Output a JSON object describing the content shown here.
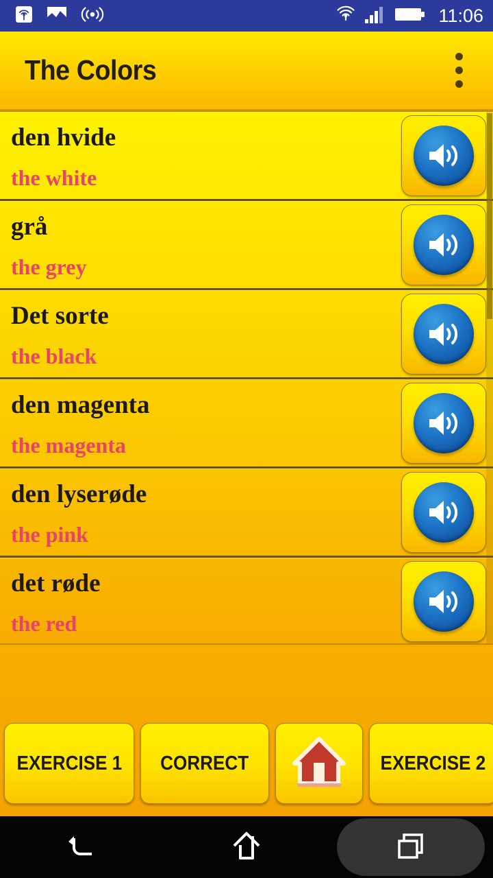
{
  "statusbar": {
    "time": "11:06",
    "left_icons": [
      {
        "name": "nfc-icon",
        "label": "nfc"
      },
      {
        "name": "screenshot-image-icon",
        "label": "screenshot"
      },
      {
        "name": "wifi-hotspot-icon",
        "label": "hotspot"
      }
    ],
    "right_icons": [
      {
        "name": "wifi-icon",
        "label": "wifi"
      },
      {
        "name": "cellular-signal-icon",
        "label": "signal"
      },
      {
        "name": "battery-icon",
        "label": "battery"
      }
    ]
  },
  "appbar": {
    "title": "The Colors",
    "overflow_menu": "overflow-menu"
  },
  "list": {
    "items": [
      {
        "native": "den hvide",
        "translation": "the white",
        "speaker": "speaker-icon"
      },
      {
        "native": "grå",
        "translation": "the grey",
        "speaker": "speaker-icon"
      },
      {
        "native": "Det sorte",
        "translation": "the black",
        "speaker": "speaker-icon"
      },
      {
        "native": "den magenta",
        "translation": "the magenta",
        "speaker": "speaker-icon"
      },
      {
        "native": "den lyserøde",
        "translation": "the pink",
        "speaker": "speaker-icon"
      },
      {
        "native": "det røde",
        "translation": "the red",
        "speaker": "speaker-icon"
      }
    ]
  },
  "footer": {
    "buttons": [
      {
        "label": "EXERCISE 1",
        "name": "exercise-1-button"
      },
      {
        "label": "CORRECT",
        "name": "correct-button"
      },
      {
        "label": "",
        "name": "home-button",
        "icon": "house-icon"
      },
      {
        "label": "EXERCISE 2",
        "name": "exercise-2-button"
      }
    ]
  },
  "navbar": {
    "back": "back-icon",
    "home": "home-icon",
    "recents": "recents-icon"
  },
  "colors": {
    "status_bar_bg": "#2B3A9B",
    "appbar_top": "#FFE800",
    "appbar_bottom": "#FBB800",
    "list_top": "#FFF200",
    "list_bottom": "#F7AC00",
    "native_text": "#1d1a12",
    "translation_text": "#E8436C",
    "speaker_blue": "#1f76c8",
    "house_red": "#C0392B",
    "nav_bg": "#040404"
  }
}
